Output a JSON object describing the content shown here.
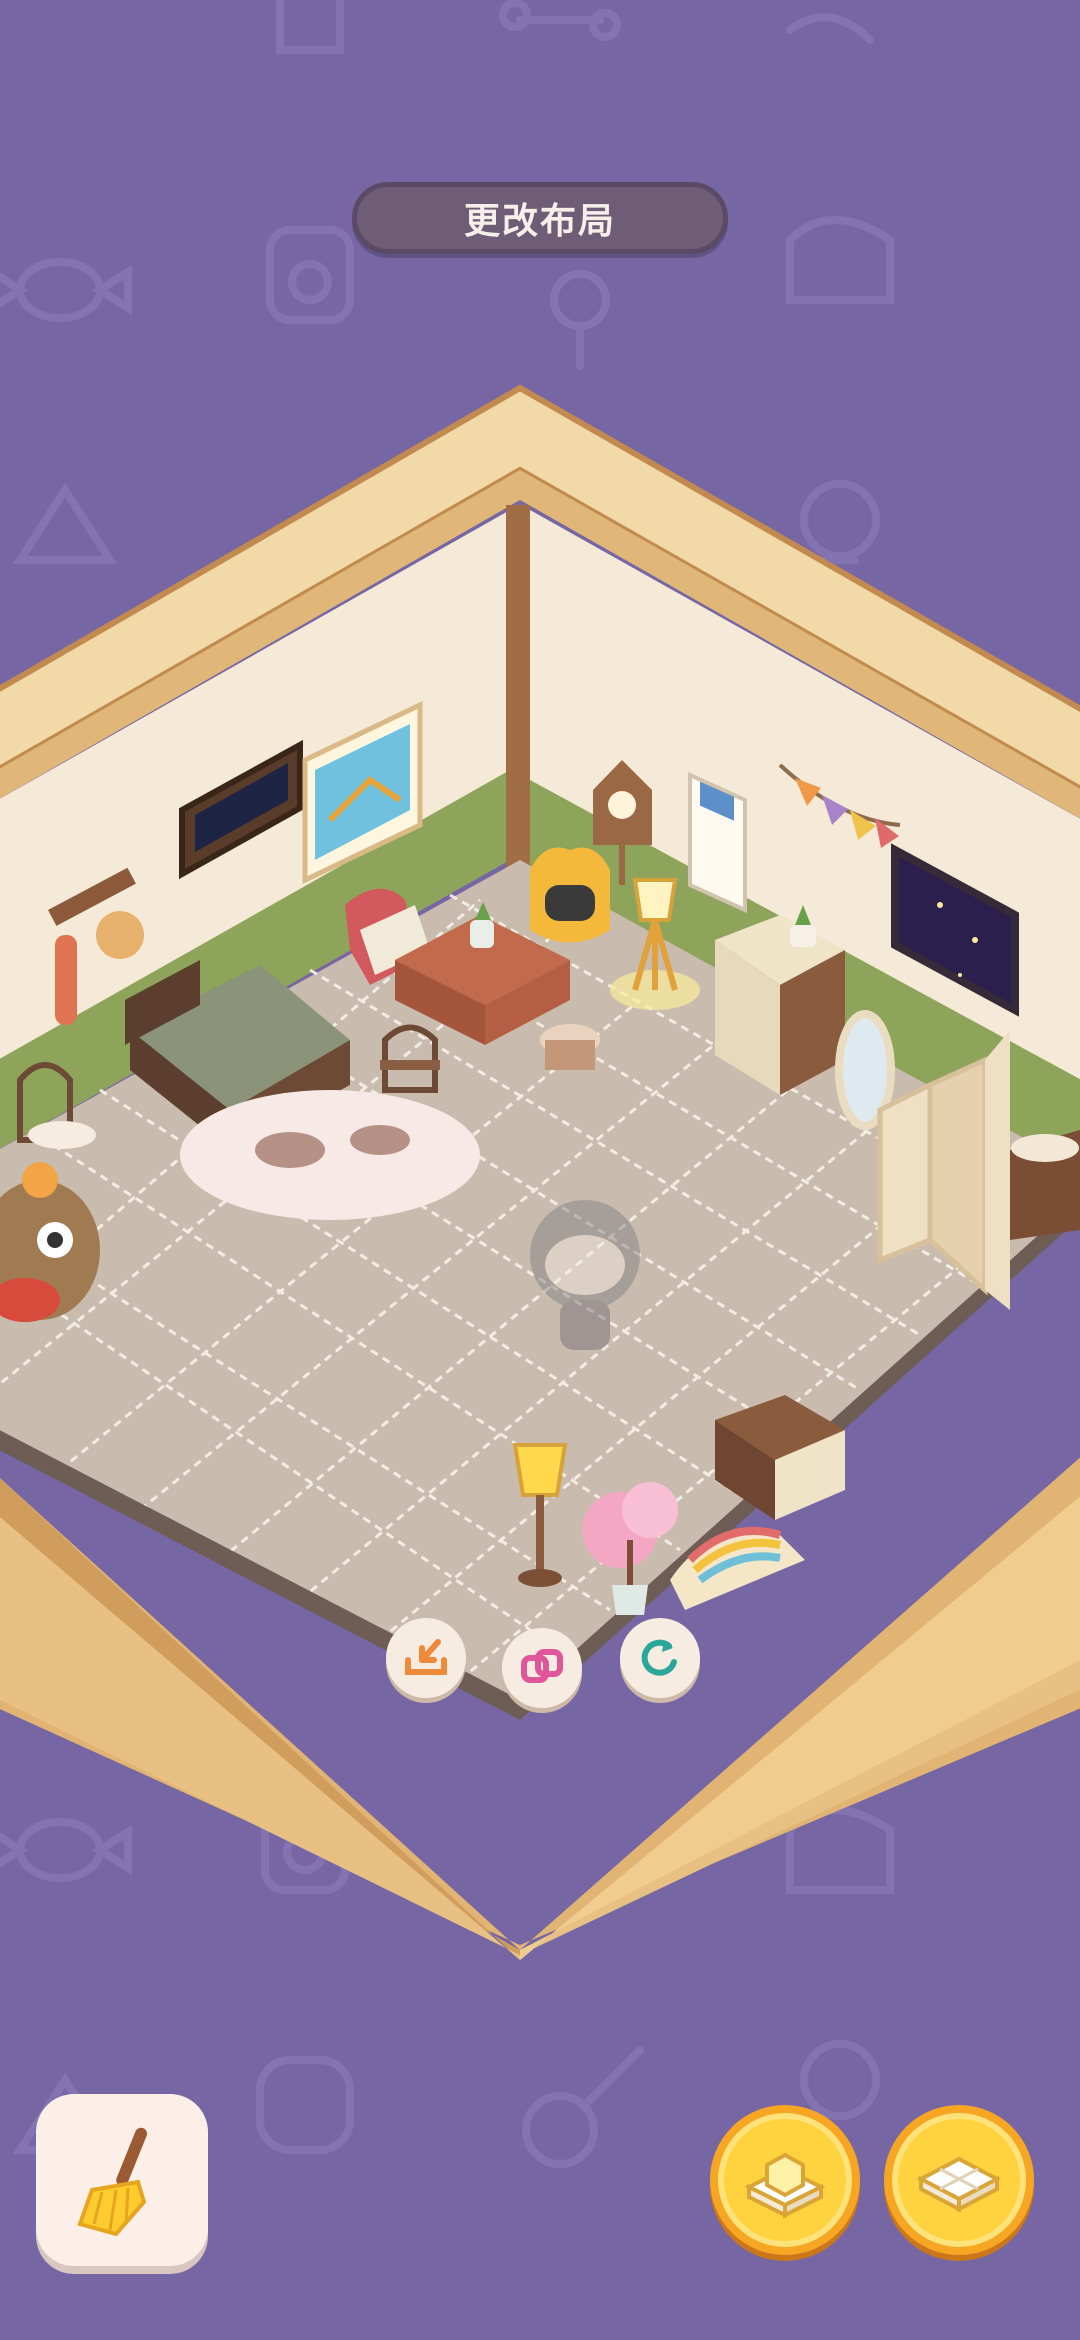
{
  "header": {
    "title": "更改布局"
  },
  "floor_actions": [
    {
      "name": "store-item-button",
      "icon": "tray-arrow-icon"
    },
    {
      "name": "swap-item-button",
      "icon": "overlap-squares-icon"
    },
    {
      "name": "rotate-item-button",
      "icon": "rotate-arrow-icon"
    }
  ],
  "bottom_bar": {
    "clean": {
      "icon": "broom-icon"
    },
    "mode_furniture": {
      "icon": "furniture-block-icon"
    },
    "mode_floor": {
      "icon": "floor-tile-icon"
    }
  },
  "colors": {
    "background": "#7666a4",
    "wall": "#f4ead7",
    "wainscot": "#8ea45b",
    "floor": "#c9bcae",
    "frame": "#f1d9a8",
    "accent_gold": "#ffd23f"
  }
}
